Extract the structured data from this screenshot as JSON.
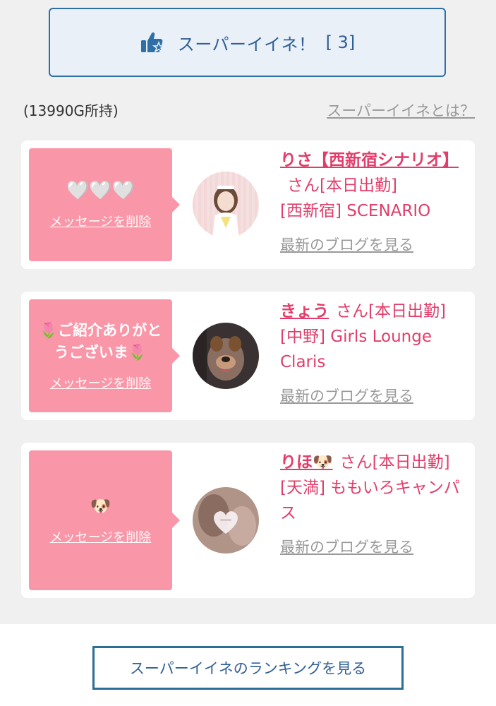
{
  "super_like": {
    "label": "スーパーイイネ！",
    "count": "[ 3]"
  },
  "owned": "(13990G所持)",
  "about_link": "スーパーイイネとは？",
  "messages": [
    {
      "message": "🤍🤍🤍",
      "delete_label": "メッセージを削除",
      "name": "りさ【西新宿シナリオ】",
      "suffix": "さん[本日出勤]",
      "shop": "[西新宿] SCENARIO",
      "blog_link": "最新のブログを見る"
    },
    {
      "message": "🌷ご紹介ありがとうございま🌷",
      "delete_label": "メッセージを削除",
      "name": "きょう",
      "suffix": "さん[本日出勤]",
      "shop": "[中野] Girls Lounge Claris",
      "blog_link": "最新のブログを見る"
    },
    {
      "message": "🐶",
      "delete_label": "メッセージを削除",
      "name": "りほ🐶",
      "suffix": "さん[本日出勤]",
      "shop": "[天満] ももいろキャンパス",
      "blog_link": "最新のブログを見る"
    }
  ],
  "ranking_button": "スーパーイイネのランキングを見る",
  "colors": {
    "accent_blue": "#2f6fa7",
    "bubble_pink": "#f996a8",
    "name_pink": "#e23d6a"
  },
  "icons": {
    "super_like": "thumbs-up-star-icon"
  }
}
